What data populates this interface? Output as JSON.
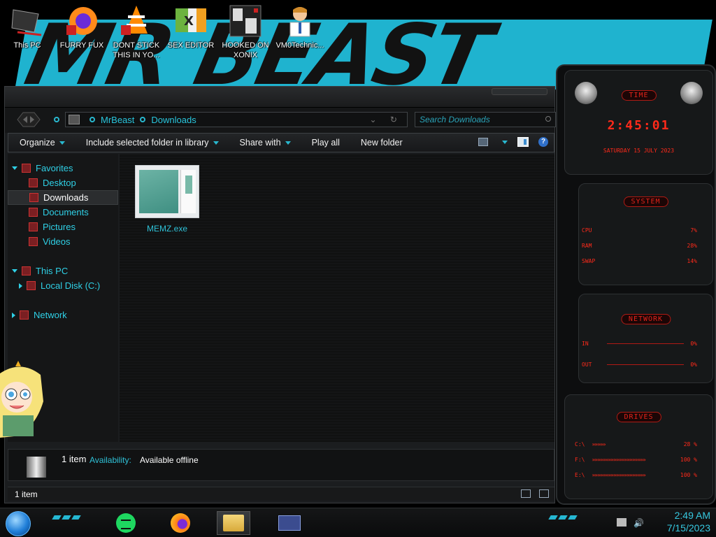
{
  "desktop": {
    "wallpaper_text": "MR BEAST",
    "icons": [
      {
        "label": "This PC",
        "icon": "computer-icon"
      },
      {
        "label": "FURRY FUX",
        "icon": "firefox-icon"
      },
      {
        "label": "DONT STICK THIS IN YO...",
        "icon": "vlc-icon"
      },
      {
        "label": "SEX EDITOR",
        "icon": "hxd-icon"
      },
      {
        "label": "HOOKED ON XONIX",
        "icon": "game-icon"
      },
      {
        "label": "VM0Technic...",
        "icon": "doctor-icon"
      }
    ]
  },
  "explorer": {
    "breadcrumb": [
      "MrBeast",
      "Downloads"
    ],
    "search_placeholder": "Search Downloads",
    "toolbar": {
      "organize": "Organize",
      "include": "Include selected folder in library",
      "share": "Share with",
      "play_all": "Play all",
      "new_folder": "New folder",
      "help": "?"
    },
    "nav": {
      "favorites": "Favorites",
      "desktop": "Desktop",
      "downloads": "Downloads",
      "documents": "Documents",
      "pictures": "Pictures",
      "videos": "Videos",
      "this_pc": "This PC",
      "local_disk": "Local Disk (C:)",
      "network": "Network"
    },
    "files": [
      {
        "name": "MEMZ.exe"
      }
    ],
    "details": {
      "count": "1 item",
      "availability_label": "Availability:",
      "availability_value": "Available offline"
    },
    "status": "1 item"
  },
  "gadget": {
    "time_title": "TIME",
    "time": "2:45:01",
    "date": "SATURDAY 15 JULY 2023",
    "system_title": "SYSTEM",
    "system_rows": [
      {
        "label": "CPU",
        "value": "7%"
      },
      {
        "label": "RAM",
        "value": "28%"
      },
      {
        "label": "SWAP",
        "value": "14%"
      }
    ],
    "network_title": "NETWORK",
    "network_rows": [
      {
        "label": "IN",
        "value": "0%"
      },
      {
        "label": "OUT",
        "value": "0%"
      }
    ],
    "drives_title": "DRIVES",
    "drive_rows": [
      {
        "label": "C:\\",
        "bar": "»»»»»",
        "value": "28 %"
      },
      {
        "label": "F:\\",
        "bar": "»»»»»»»»»»»»»»»»»»»»",
        "value": "100 %"
      },
      {
        "label": "E:\\",
        "bar": "»»»»»»»»»»»»»»»»»»»»",
        "value": "100 %"
      }
    ]
  },
  "taskbar": {
    "time": "2:49 AM",
    "date": "7/15/2023"
  },
  "colors": {
    "accent": "#29c6dd",
    "gadget_red": "#ff2a1a",
    "wallpaper_cyan": "#1fb3cf"
  }
}
